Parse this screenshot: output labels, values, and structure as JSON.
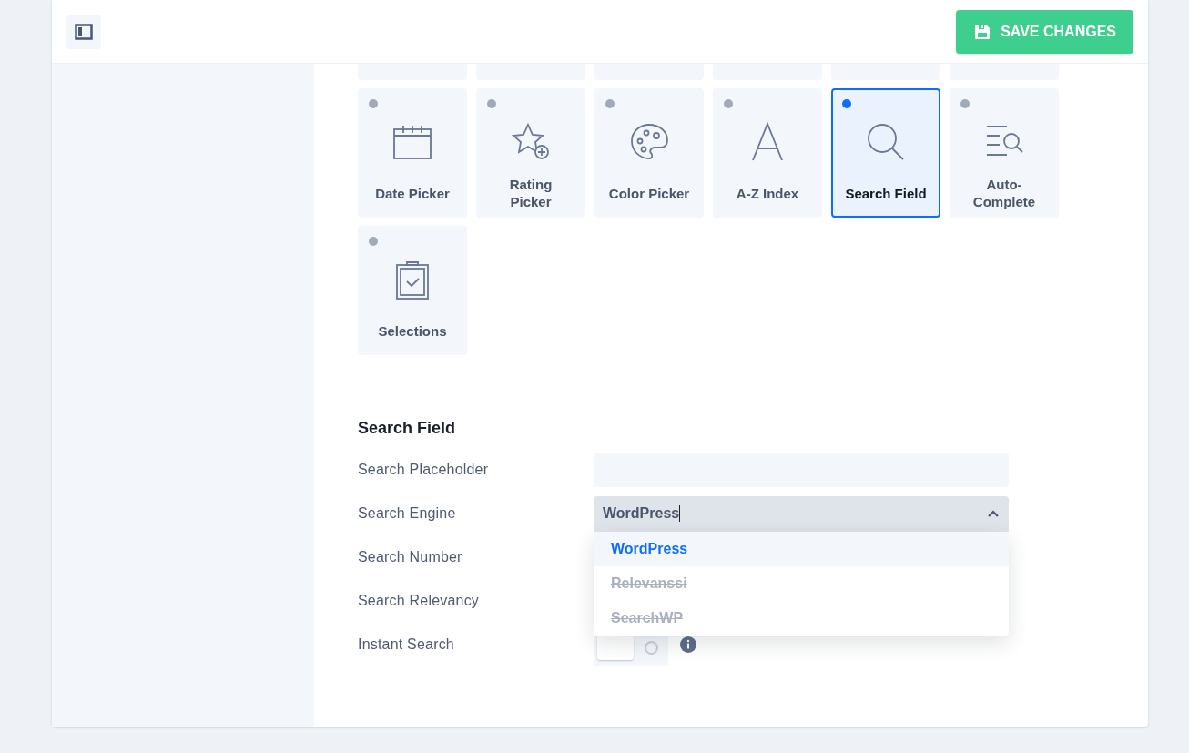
{
  "header": {
    "save_button": "SAVE CHANGES"
  },
  "tiles": [
    {
      "label": "Date Picker",
      "kind": "date",
      "selected": false
    },
    {
      "label": "Rating Picker",
      "kind": "rating",
      "selected": false
    },
    {
      "label": "Color Picker",
      "kind": "color",
      "selected": false
    },
    {
      "label": "A-Z Index",
      "kind": "index",
      "selected": false
    },
    {
      "label": "Search Field",
      "kind": "search",
      "selected": true
    },
    {
      "label": "Auto-Complete",
      "kind": "autocomplete",
      "selected": false
    },
    {
      "label": "Selections",
      "kind": "selections",
      "selected": false
    }
  ],
  "section": {
    "title": "Search Field",
    "fields": [
      {
        "label": "Search Placeholder",
        "kind": "text"
      },
      {
        "label": "Search Engine",
        "kind": "select",
        "value": "WordPress",
        "expanded": true,
        "options": [
          {
            "label": "WordPress",
            "selected": true,
            "disabled": false
          },
          {
            "label": "Relevanssi",
            "selected": false,
            "disabled": true
          },
          {
            "label": "SearchWP",
            "selected": false,
            "disabled": true
          }
        ]
      },
      {
        "label": "Search Number",
        "kind": "covered"
      },
      {
        "label": "Search Relevancy",
        "kind": "covered"
      },
      {
        "label": "Instant Search",
        "kind": "toggle",
        "on": false
      }
    ]
  }
}
